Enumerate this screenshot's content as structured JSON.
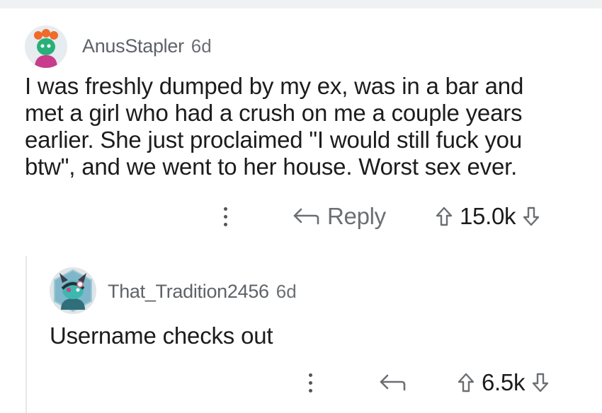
{
  "comments": [
    {
      "username": "AnusStapler",
      "age": "6d",
      "body": "I was freshly dumped by my ex, was in a bar and met a girl who had a crush on me a couple years earlier. She just proclaimed \"I would still fuck you btw\", and we went to her house. Worst sex ever.",
      "reply_label": "Reply",
      "score": "15.0k"
    },
    {
      "username": "That_Tradition2456",
      "age": "6d",
      "body": "Username checks out",
      "score": "6.5k"
    }
  ],
  "icons": {
    "more": "more-vertical-icon",
    "reply": "reply-arrow-icon",
    "upvote": "upvote-arrow-icon",
    "downvote": "downvote-arrow-icon"
  },
  "colors": {
    "text": "#1c1c1c",
    "meta": "#5f6368",
    "icon": "#6b6f73",
    "thread_line": "#e8e8e8"
  }
}
